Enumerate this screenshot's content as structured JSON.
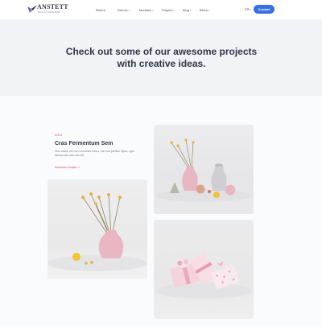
{
  "header": {
    "logo_name": "ANSTETT",
    "logo_tagline": "SOLUTIONS PRO",
    "nav": [
      {
        "label": "Retour",
        "caret": false
      },
      {
        "label": "Demos",
        "caret": true
      },
      {
        "label": "Modules",
        "caret": true
      },
      {
        "label": "Projets",
        "caret": true
      },
      {
        "label": "Blog",
        "caret": true
      },
      {
        "label": "Blocs",
        "caret": true
      }
    ],
    "language": "FR",
    "contact_label": "Contact"
  },
  "hero": {
    "title": "Check out some of our awesome projects with creative ideas."
  },
  "project": {
    "tag": "IDEA",
    "title": "Cras Fermentum Sem",
    "description": "Duis mollis, est non commodo luctus, nisi erat porttitor ligula, eget lacinia odio sem nec elit.",
    "link": "Nouveaux projets ↗"
  },
  "photos": [
    {
      "name": "vases-and-objects-photo"
    },
    {
      "name": "pink-vase-with-flowers-photo"
    },
    {
      "name": "gift-boxes-photo"
    }
  ],
  "colors": {
    "accent": "#3a6fe0",
    "tag": "#e84a5a",
    "heading": "#2f3645",
    "hero_bg": "#f2f3f6"
  }
}
